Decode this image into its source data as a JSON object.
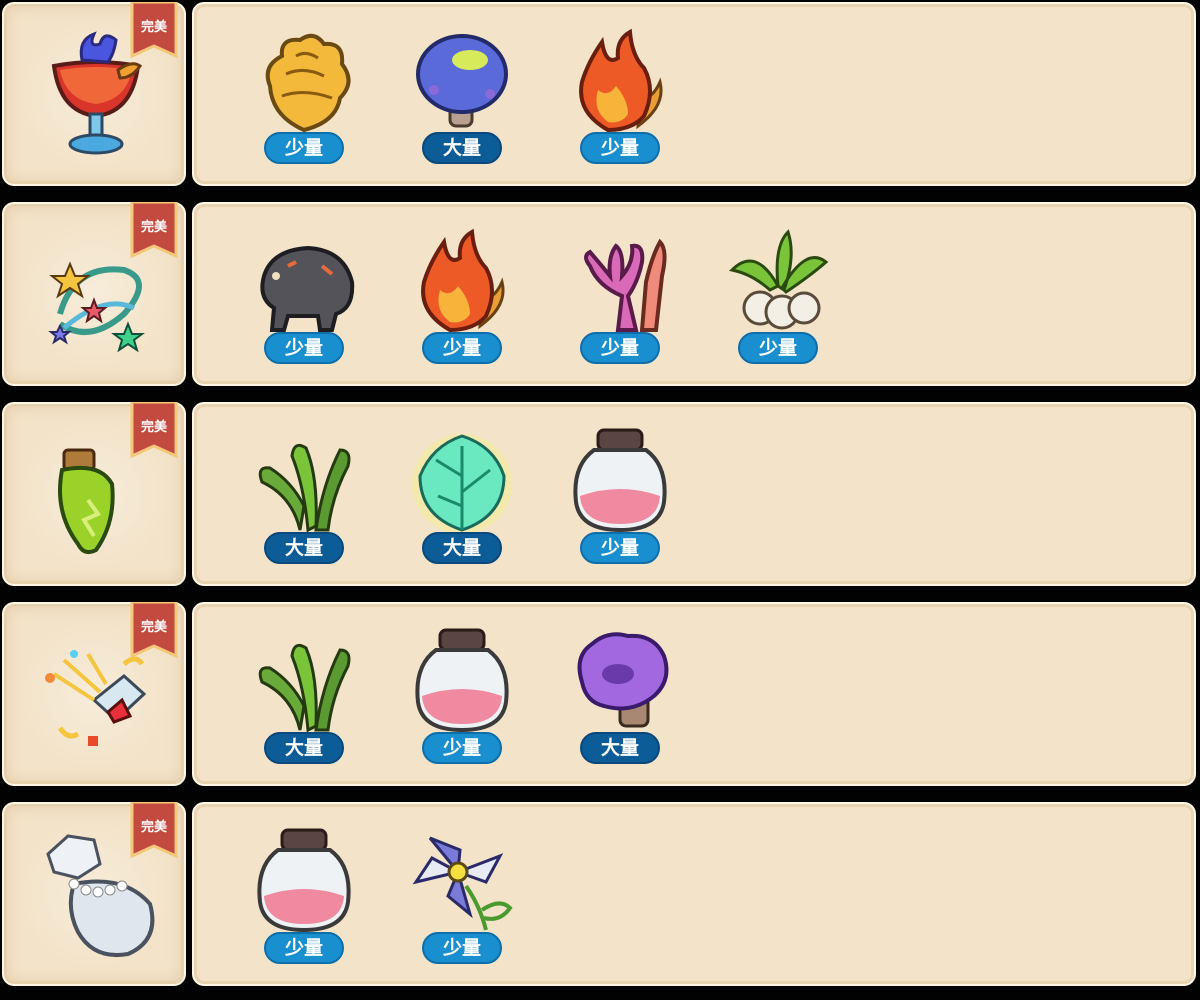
{
  "recipes": [
    {
      "product_icon": "flaming-red-drink-glass-icon",
      "quality_label": "完美",
      "ingredients": [
        {
          "icon": "golden-leaf-cluster-icon",
          "amount": "少量"
        },
        {
          "icon": "blue-slime-mushroom-icon",
          "amount": "大量"
        },
        {
          "icon": "flame-leaf-icon",
          "amount": "少量"
        }
      ]
    },
    {
      "product_icon": "star-garland-icon",
      "quality_label": "完美",
      "ingredients": [
        {
          "icon": "stone-boar-icon",
          "amount": "少量"
        },
        {
          "icon": "flame-leaf-icon",
          "amount": "少量"
        },
        {
          "icon": "pink-coral-icon",
          "amount": "少量"
        },
        {
          "icon": "turnip-plant-icon",
          "amount": "少量"
        }
      ]
    },
    {
      "product_icon": "green-potion-bottle-icon",
      "quality_label": "完美",
      "ingredients": [
        {
          "icon": "green-grass-blades-icon",
          "amount": "大量"
        },
        {
          "icon": "glowing-teal-leaf-icon",
          "amount": "大量"
        },
        {
          "icon": "pink-powder-jar-icon",
          "amount": "少量"
        }
      ]
    },
    {
      "product_icon": "party-popper-bottle-icon",
      "quality_label": "完美",
      "ingredients": [
        {
          "icon": "green-grass-blades-icon",
          "amount": "大量"
        },
        {
          "icon": "pink-powder-jar-icon",
          "amount": "少量"
        },
        {
          "icon": "purple-fungus-icon",
          "amount": "大量"
        }
      ]
    },
    {
      "product_icon": "crystal-pearl-vase-icon",
      "quality_label": "完美",
      "ingredients": [
        {
          "icon": "pink-powder-jar-icon",
          "amount": "少量"
        },
        {
          "icon": "pinwheel-flower-icon",
          "amount": "少量"
        }
      ]
    }
  ]
}
